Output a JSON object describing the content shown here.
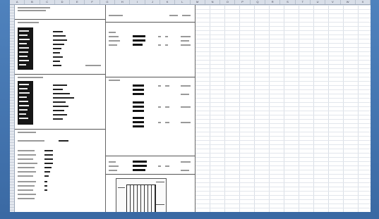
{
  "columns": [
    "A",
    "B",
    "C",
    "D",
    "E",
    "F",
    "G",
    "H",
    "I",
    "J",
    "K",
    "L",
    "M",
    "N",
    "O",
    "P",
    "Q",
    "R",
    "S",
    "T",
    "U",
    "V",
    "W",
    "X"
  ],
  "colors": {
    "frame": "#3e6fa8",
    "cell_block": "#161616"
  }
}
